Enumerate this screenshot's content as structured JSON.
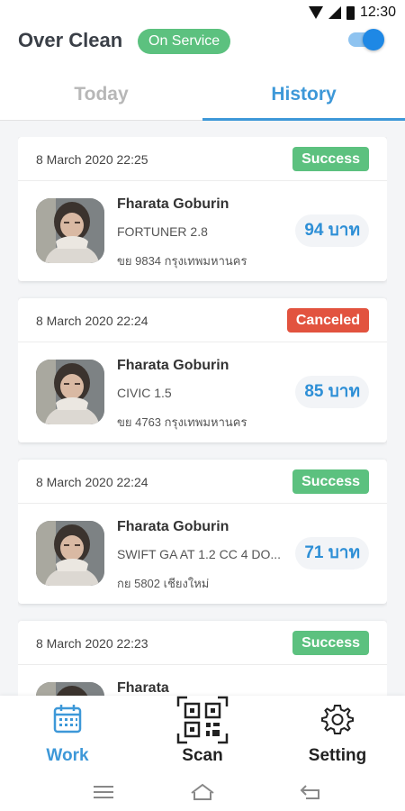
{
  "status_bar": {
    "time": "12:30"
  },
  "header": {
    "title": "Over Clean",
    "service_badge": "On Service",
    "toggle_on": true,
    "accent": "#1e88e5"
  },
  "tabs": [
    {
      "label": "Today",
      "active": false
    },
    {
      "label": "History",
      "active": true
    }
  ],
  "colors": {
    "success": "#5cc17f",
    "canceled": "#e2533f",
    "price_text": "#2e8fd6"
  },
  "orders": [
    {
      "date": "8 March 2020 22:25",
      "status": "Success",
      "name": "Fharata Goburin",
      "car": "FORTUNER 2.8",
      "plate": "ขย 9834 กรุงเทพมหานคร",
      "price": "94 บาท"
    },
    {
      "date": "8 March 2020 22:24",
      "status": "Canceled",
      "name": "Fharata Goburin",
      "car": "CIVIC 1.5",
      "plate": "ขย 4763 กรุงเทพมหานคร",
      "price": "85 บาท"
    },
    {
      "date": "8 March 2020 22:24",
      "status": "Success",
      "name": "Fharata Goburin",
      "car": "SWIFT GA AT 1.2 CC 4 DO...",
      "plate": "กย 5802 เชียงใหม่",
      "price": "71 บาท"
    },
    {
      "date": "8 March 2020 22:23",
      "status": "Success",
      "name": "Fharata",
      "car": "",
      "plate": "",
      "price": ""
    }
  ],
  "bottom_nav": [
    {
      "label": "Work",
      "icon": "calendar-icon",
      "active": true
    },
    {
      "label": "Scan",
      "icon": "qr-code-icon",
      "active": false
    },
    {
      "label": "Setting",
      "icon": "gear-icon",
      "active": false
    }
  ],
  "system_nav": [
    "menu-icon",
    "home-icon",
    "back-icon"
  ]
}
